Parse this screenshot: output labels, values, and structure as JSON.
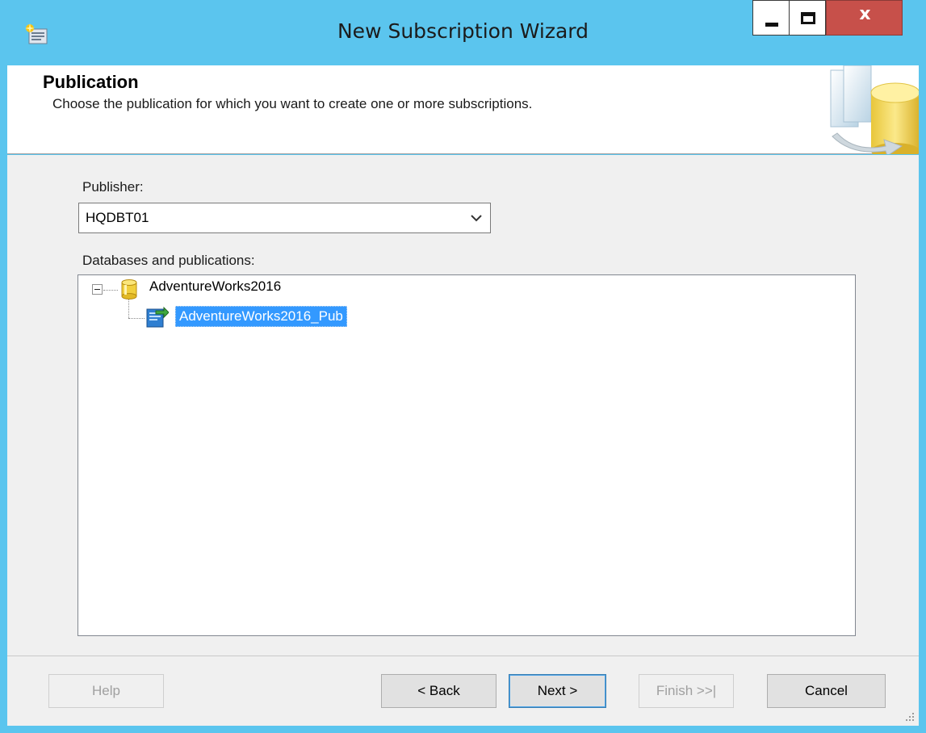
{
  "window": {
    "title": "New Subscription Wizard",
    "close_glyph": "x"
  },
  "header": {
    "title": "Publication",
    "subtitle": "Choose the publication for which you want to create one or more subscriptions."
  },
  "publisher": {
    "label": "Publisher:",
    "value": "HQDBT01"
  },
  "tree": {
    "label": "Databases and publications:",
    "database": "AdventureWorks2016",
    "publication": "AdventureWorks2016_Pub"
  },
  "buttons": {
    "help": "Help",
    "back": "< Back",
    "next": "Next >",
    "finish": "Finish >>|",
    "cancel": "Cancel"
  },
  "colors": {
    "title_bar": "#5bc5ee",
    "close_button": "#c7504a",
    "selection": "#3399ff"
  },
  "icons": [
    "app-icon",
    "minimize-icon",
    "maximize-icon",
    "close-icon",
    "wizard-banner-icon",
    "chevron-down-icon",
    "collapse-icon",
    "database-icon",
    "publication-icon",
    "resize-grip-icon"
  ]
}
